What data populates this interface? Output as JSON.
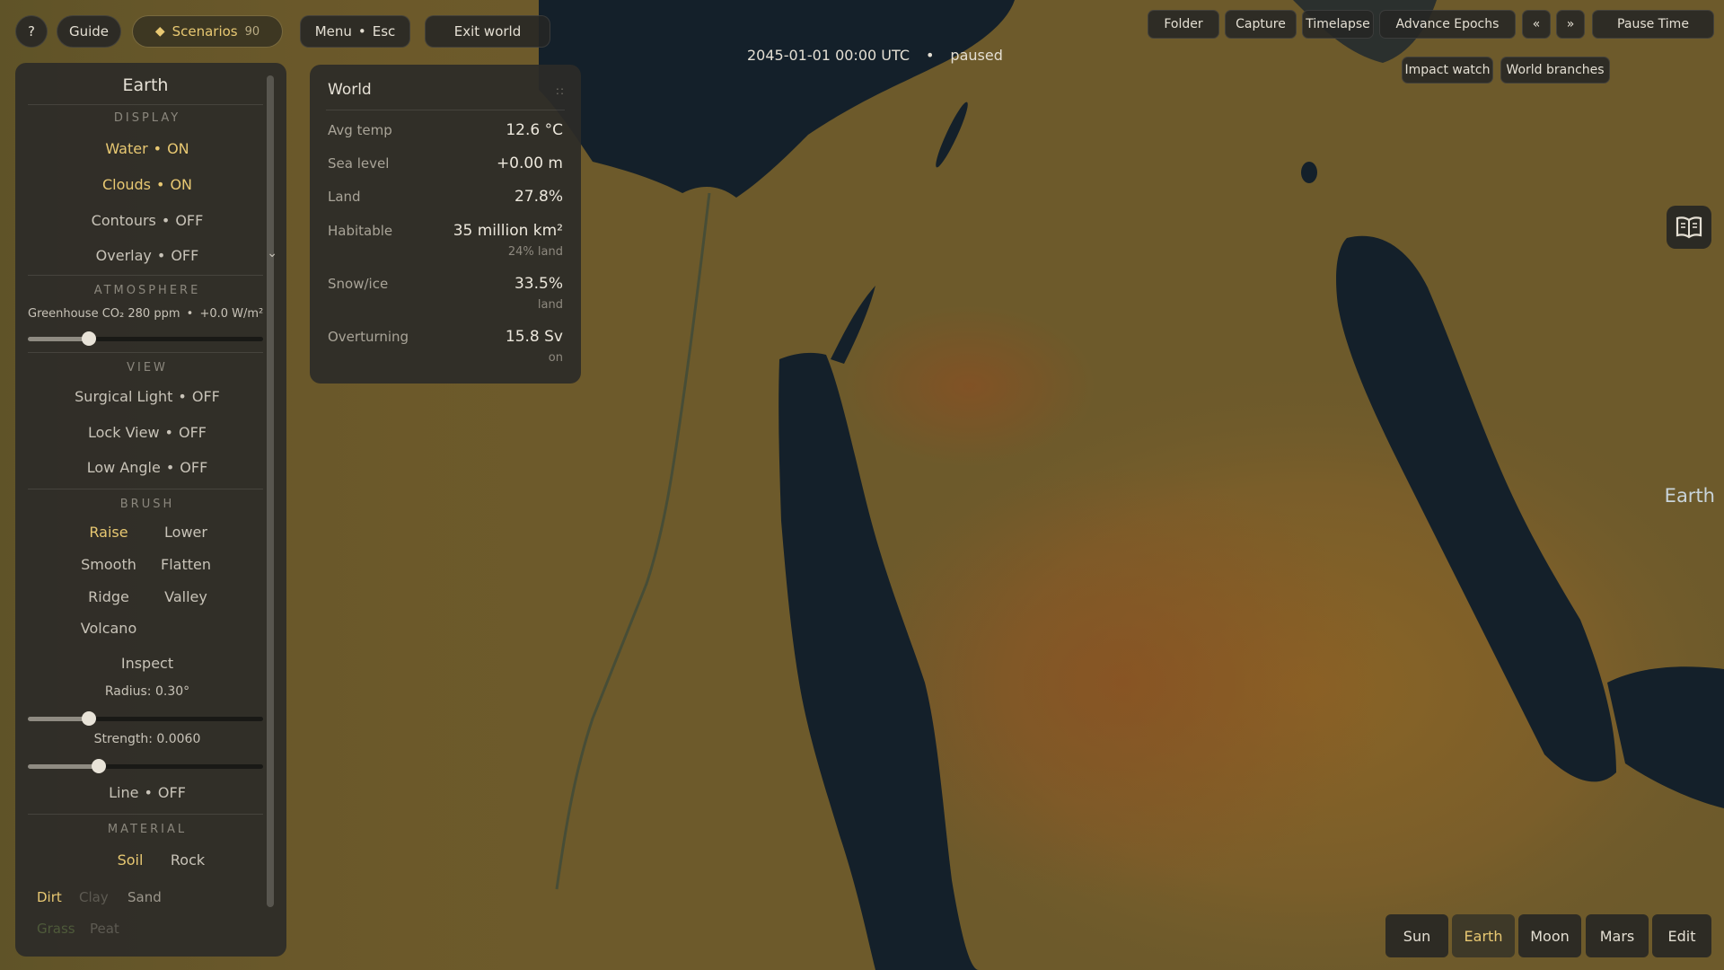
{
  "topbar": {
    "help_label": "?",
    "guide_label": "Guide",
    "scenarios_label": "Scenarios",
    "scenarios_count": "90",
    "menu_label": "Menu",
    "menu_key": "Esc",
    "exit_label": "Exit world"
  },
  "status": {
    "datetime": "2045-01-01 00:00 UTC",
    "separator": "•",
    "state": "paused"
  },
  "toolbar_right": {
    "folder": "Folder",
    "capture": "Capture",
    "timelapse": "Timelapse",
    "advance": "Advance Epochs",
    "rewind": "«",
    "forward": "»",
    "pause": "Pause Time",
    "impact_watch": "Impact watch",
    "world_branches": "World branches"
  },
  "left_panel": {
    "title": "Earth",
    "display": {
      "heading": "DISPLAY",
      "water": {
        "label": "Water",
        "state": "ON"
      },
      "clouds": {
        "label": "Clouds",
        "state": "ON"
      },
      "contours": {
        "label": "Contours",
        "state": "OFF"
      },
      "overlay": {
        "label": "Overlay",
        "state": "OFF"
      }
    },
    "atmosphere": {
      "heading": "ATMOSPHERE",
      "greenhouse_label": "Greenhouse",
      "co2": "CO₂ 280 ppm",
      "forcing": "+0.0 W/m²",
      "slider_fraction": 0.26
    },
    "view": {
      "heading": "VIEW",
      "surgical": {
        "label": "Surgical Light",
        "state": "OFF"
      },
      "lock": {
        "label": "Lock View",
        "state": "OFF"
      },
      "low_angle": {
        "label": "Low Angle",
        "state": "OFF"
      }
    },
    "brush": {
      "heading": "BRUSH",
      "raise": "Raise",
      "lower": "Lower",
      "smooth": "Smooth",
      "flatten": "Flatten",
      "ridge": "Ridge",
      "valley": "Valley",
      "volcano": "Volcano",
      "inspect": "Inspect",
      "radius_label": "Radius: 0.30°",
      "radius_fraction": 0.26,
      "strength_label": "Strength: 0.0060",
      "strength_fraction": 0.3,
      "line": {
        "label": "Line",
        "state": "OFF"
      }
    },
    "material": {
      "heading": "MATERIAL",
      "soil": "Soil",
      "rock": "Rock",
      "dirt": "Dirt",
      "clay": "Clay",
      "sand": "Sand",
      "grass": "Grass",
      "peat": "Peat"
    }
  },
  "world_panel": {
    "title": "World",
    "grip": "::",
    "rows": [
      {
        "label": "Avg temp",
        "value": "12.6 °C",
        "sub": ""
      },
      {
        "label": "Sea level",
        "value": "+0.00 m",
        "sub": ""
      },
      {
        "label": "Land",
        "value": "27.8%",
        "sub": ""
      },
      {
        "label": "Habitable",
        "value": "35 million km²",
        "sub": "24% land"
      },
      {
        "label": "Snow/ice",
        "value": "33.5%",
        "sub": "land"
      },
      {
        "label": "Overturning",
        "value": "15.8 Sv",
        "sub": "on"
      }
    ]
  },
  "planet_label": "Earth",
  "planets": {
    "sun": "Sun",
    "earth": "Earth",
    "moon": "Moon",
    "mars": "Mars",
    "edit": "Edit"
  },
  "colors": {
    "accent": "#e8c872",
    "panel": "#2c2b28",
    "land": "#6f5a2a",
    "water": "#14202a"
  }
}
